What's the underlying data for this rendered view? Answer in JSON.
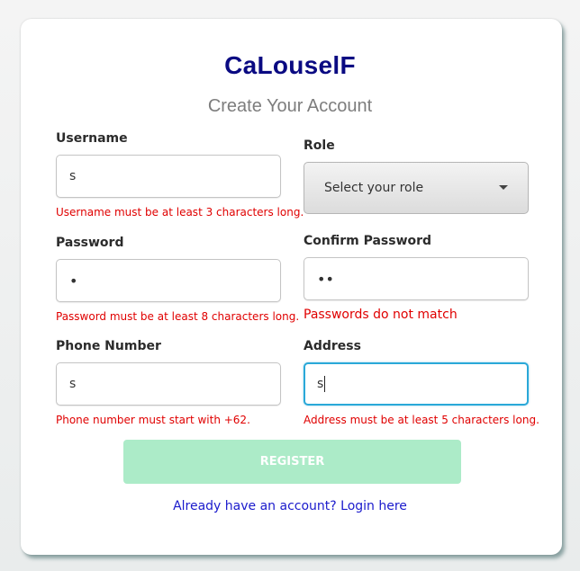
{
  "header": {
    "title": "CaLouselF",
    "subtitle": "Create Your Account"
  },
  "form": {
    "username": {
      "label": "Username",
      "value": "s",
      "error": "Username must be at least 3 characters long."
    },
    "role": {
      "label": "Role",
      "selected": "Select your role"
    },
    "password": {
      "label": "Password",
      "value": "•",
      "error": "Password must be at least 8 characters long."
    },
    "confirm_password": {
      "label": "Confirm Password",
      "value": "••",
      "error": "Passwords do not match"
    },
    "phone": {
      "label": "Phone Number",
      "value": "s",
      "error": "Phone number must start with +62."
    },
    "address": {
      "label": "Address",
      "value": "s",
      "error": "Address must be at least 5 characters long."
    },
    "register_label": "REGISTER",
    "login_link": "Already have an account? Login here"
  },
  "colors": {
    "title": "#0a0a82",
    "error": "#e00000",
    "register_bg": "#acebc8",
    "link": "#1a1acc",
    "focus_border": "#2aa8d8"
  },
  "icons": {
    "role_dropdown": "chevron-down-icon"
  }
}
